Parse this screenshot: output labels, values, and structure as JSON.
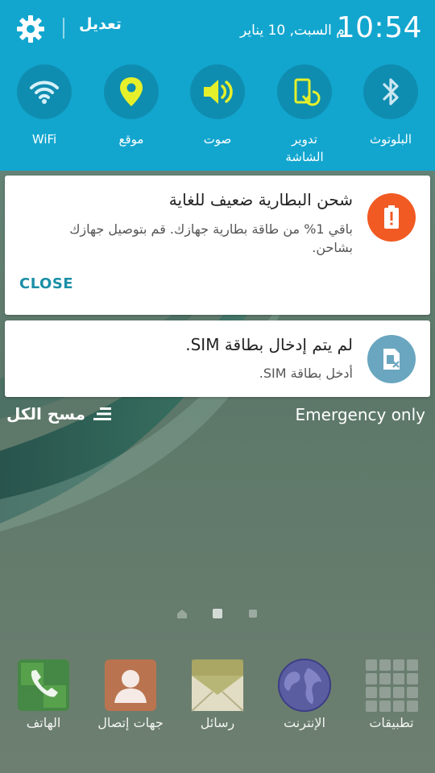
{
  "status_panel": {
    "time": "10:54",
    "date": "م السبت, 10 يناير",
    "edit_label": "تعديل",
    "accent_color": "#12a6cf"
  },
  "quick_toggles": [
    {
      "label": "WiFi",
      "icon": "wifi-icon"
    },
    {
      "label": "موقع",
      "icon": "location-pin-icon"
    },
    {
      "label": "صوت",
      "icon": "speaker-icon"
    },
    {
      "label": "تدوير الشاشة",
      "icon": "screen-rotation-icon"
    },
    {
      "label": "البلوتوث",
      "icon": "bluetooth-icon"
    }
  ],
  "notifications": [
    {
      "title": "شحن البطارية ضعيف للغاية",
      "body": "باقي 1% من طاقة بطارية جهازك. قم بتوصيل جهازك بشاحن.",
      "action": "CLOSE",
      "icon": "battery-warning-icon",
      "icon_color": "#f15a23"
    },
    {
      "title": "لم يتم إدخال بطاقة SIM.",
      "body": "أدخل بطاقة SIM.",
      "icon": "sim-card-missing-icon",
      "icon_color": "#6aa6bf"
    }
  ],
  "footer": {
    "clear_all": "مسح الكل",
    "emergency": "Emergency only"
  },
  "dock": [
    {
      "label": "تطبيقات",
      "icon": "apps-grid-icon"
    },
    {
      "label": "الإنترنت",
      "icon": "globe-icon"
    },
    {
      "label": "رسائل",
      "icon": "envelope-icon"
    },
    {
      "label": "جهات إتصال",
      "icon": "contacts-icon"
    },
    {
      "label": "الهاتف",
      "icon": "phone-icon"
    }
  ]
}
